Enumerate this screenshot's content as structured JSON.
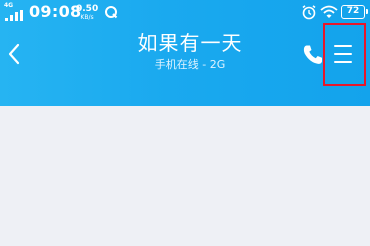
{
  "status_bar": {
    "network": "4G",
    "time": "09:08",
    "speed_value": "0.50",
    "speed_unit": "KB/s",
    "battery": "72",
    "icons": [
      "signal-icon",
      "qq-icon",
      "alarm-icon",
      "wifi-icon",
      "battery-icon"
    ]
  },
  "header": {
    "title": "如果有一天",
    "subtitle": "手机在线 - 2G",
    "back_icon": "chevron-left-icon",
    "call_icon": "phone-icon",
    "menu_icon": "hamburger-menu-icon"
  },
  "colors": {
    "header_start": "#26b4f2",
    "header_end": "#13a3ec",
    "highlight_box": "#e8172a",
    "chat_background": "#eef0f5"
  }
}
